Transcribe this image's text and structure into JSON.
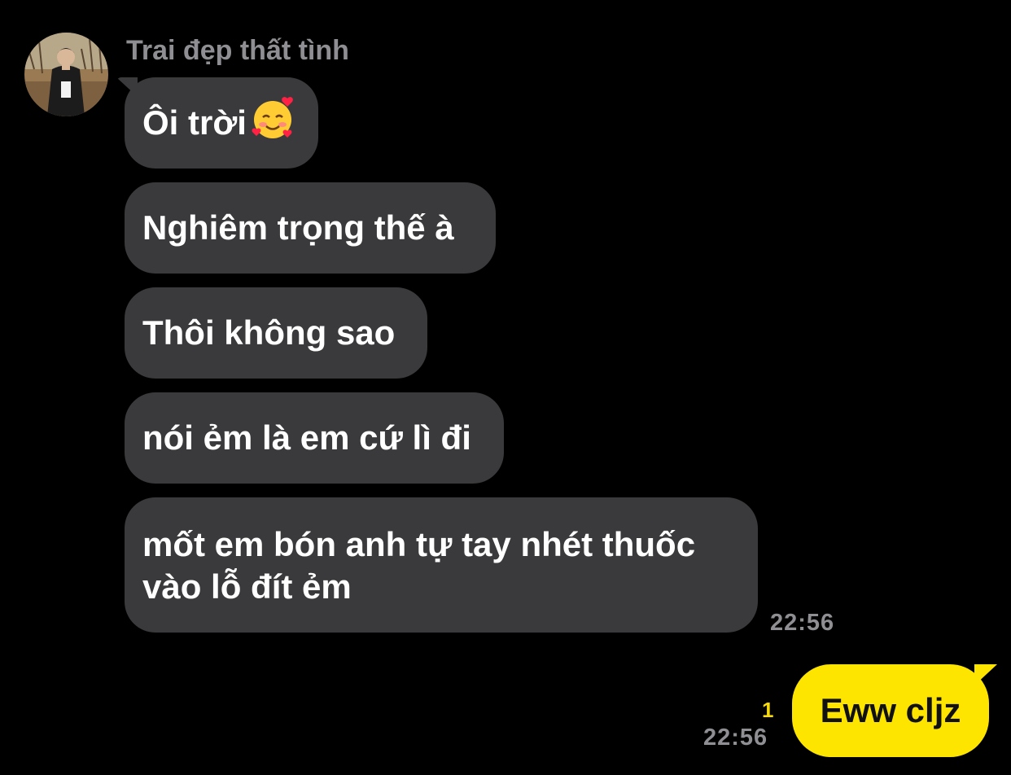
{
  "chat": {
    "sender_name": "Trai đẹp thất tình",
    "incoming": [
      {
        "text": "Ôi trời",
        "emoji": "smiling-face-with-hearts"
      },
      {
        "text": "Nghiêm trọng thế à"
      },
      {
        "text": "Thôi không sao"
      },
      {
        "text": "nói ẻm là em cứ lì đi"
      },
      {
        "line1": "mốt em bón anh tự tay nhét thuốc",
        "line2": "vào lỗ đít ẻm"
      }
    ],
    "incoming_time": "22:56",
    "outgoing": {
      "text": "Eww cljz",
      "unread_count": "1",
      "time": "22:56"
    }
  },
  "colors": {
    "background": "#000000",
    "incoming_bubble": "#3a3a3c",
    "outgoing_bubble": "#fee500",
    "timestamp": "#8e8e93",
    "unread": "#f5d90a"
  }
}
